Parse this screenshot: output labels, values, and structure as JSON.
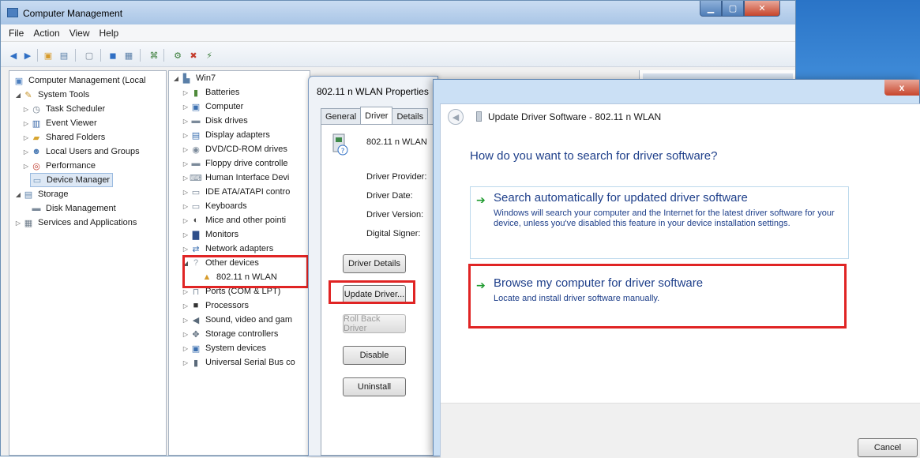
{
  "colors": {
    "accent_red": "#e02424",
    "link_blue": "#1e3f8a",
    "arrow_green": "#1f9b2f"
  },
  "window": {
    "title": "Computer Management",
    "menu": [
      "File",
      "Action",
      "View",
      "Help"
    ]
  },
  "tree": {
    "root": "Computer Management (Local",
    "system_tools": "System Tools",
    "task_scheduler": "Task Scheduler",
    "event_viewer": "Event Viewer",
    "shared_folders": "Shared Folders",
    "local_users": "Local Users and Groups",
    "performance": "Performance",
    "device_manager": "Device Manager",
    "storage": "Storage",
    "disk_management": "Disk Management",
    "services": "Services and Applications"
  },
  "devices": {
    "root": "Win7",
    "items": [
      "Batteries",
      "Computer",
      "Disk drives",
      "Display adapters",
      "DVD/CD-ROM drives",
      "Floppy drive controlle",
      "Human Interface Devi",
      "IDE ATA/ATAPI contro",
      "Keyboards",
      "Mice and other pointi",
      "Monitors",
      "Network adapters",
      "Other devices"
    ],
    "wlan": "802.11 n WLAN",
    "after": [
      "Ports (COM & LPT)",
      "Processors",
      "Sound, video and gam",
      "Storage controllers",
      "System devices",
      "Universal Serial Bus co"
    ]
  },
  "props": {
    "title": "802.11 n WLAN Properties",
    "tabs": [
      "General",
      "Driver",
      "Details"
    ],
    "device_name": "802.11 n WLAN",
    "labels": [
      "Driver Provider:",
      "Driver Date:",
      "Driver Version:",
      "Digital Signer:"
    ],
    "buttons": {
      "details": "Driver Details",
      "update": "Update Driver...",
      "rollback": "Roll Back Driver",
      "disable": "Disable",
      "uninstall": "Uninstall"
    }
  },
  "update": {
    "title": "Update Driver Software - 802.11 n WLAN",
    "question": "How do you want to search for driver software?",
    "option1": {
      "title": "Search automatically for updated driver software",
      "desc": "Windows will search your computer and the Internet for the latest driver software for your device, unless you've disabled this feature in your device installation settings."
    },
    "option2": {
      "title": "Browse my computer for driver software",
      "desc": "Locate and install driver software manually."
    },
    "cancel": "Cancel",
    "close": "x"
  }
}
